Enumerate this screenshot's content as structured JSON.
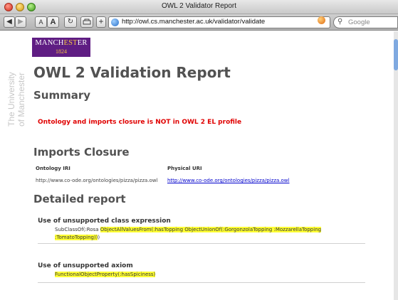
{
  "window": {
    "title": "OWL 2 Validator Report"
  },
  "toolbar": {
    "back_icon": "back-arrow",
    "forward_icon": "forward-arrow",
    "text_smaller": "A",
    "text_larger": "A",
    "reload_icon": "reload",
    "add_bookmark_label": "+",
    "url": "http://owl.cs.manchester.ac.uk/validator/validate",
    "search_placeholder": "Google"
  },
  "branding": {
    "university_text_line1": "The University",
    "university_text_line2": "of Manchester",
    "logo_name_main": "MANCH",
    "logo_name_highlight": "EST",
    "logo_name_end": "ER",
    "logo_year": "1824",
    "logo_color": "#5f1d83"
  },
  "report": {
    "title": "OWL 2 Validation Report",
    "summary_heading": "Summary",
    "summary_message": "Ontology and imports closure is NOT in OWL 2 EL profile",
    "imports_heading": "Imports Closure",
    "imports_columns": [
      "Ontology IRI",
      "Physical URI"
    ],
    "imports_rows": [
      {
        "ontology_iri": "http://www.co-ode.org/ontologies/pizza/pizza.owl",
        "physical_uri": "http://www.co-ode.org/ontologies/pizza/pizza.owl"
      }
    ],
    "detailed_heading": "Detailed report",
    "issues": [
      {
        "title": "Use of unsupported class expression",
        "axiom_prefix": "SubClassOf(:Rosa ",
        "axiom_highlight_line1": "ObjectAllValuesFrom(:hasTopping ObjectUnionOf(:GorgonzolaTopping :MozzarellaTopping",
        "axiom_highlight_line2": ":TomatoTopping))",
        "axiom_suffix": ")"
      },
      {
        "title": "Use of unsupported axiom",
        "axiom_highlight_line1": "FunctionalObjectProperty(:hasSpiciness)"
      }
    ]
  },
  "colors": {
    "alert": "#e00000",
    "highlight": "#ffff33",
    "heading": "#525252",
    "link": "#0000cc"
  }
}
